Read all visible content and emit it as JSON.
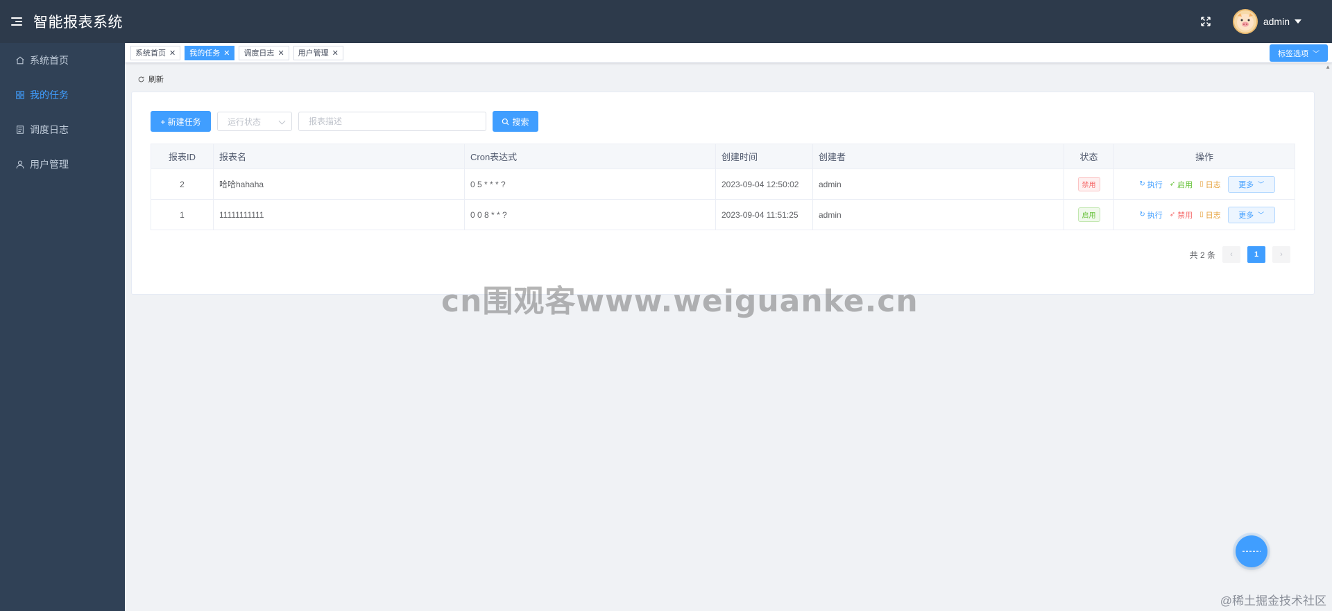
{
  "header": {
    "title": "智能报表系统",
    "username": "admin"
  },
  "sidebar": {
    "items": [
      {
        "label": "系统首页",
        "icon": "home-icon"
      },
      {
        "label": "我的任务",
        "icon": "grid-icon",
        "active": true
      },
      {
        "label": "调度日志",
        "icon": "document-icon"
      },
      {
        "label": "用户管理",
        "icon": "user-icon"
      }
    ]
  },
  "tags": {
    "items": [
      "系统首页",
      "我的任务",
      "调度日志",
      "用户管理"
    ],
    "active_index": 1,
    "options_label": "标签选项"
  },
  "toolbar": {
    "refresh_label": "刷新",
    "new_task_label": "+ 新建任务",
    "status_placeholder": "运行状态",
    "desc_placeholder": "报表描述",
    "search_label": "搜索"
  },
  "table": {
    "headers": [
      "报表ID",
      "报表名",
      "Cron表达式",
      "创建时间",
      "创建者",
      "状态",
      "操作"
    ],
    "rows": [
      {
        "id": "2",
        "name": "哈哈hahaha",
        "cron": "0 5 * * * ?",
        "created": "2023-09-04 12:50:02",
        "creator": "admin",
        "status": "禁用",
        "status_color": "#f56c6c",
        "toggle": "启用",
        "toggle_color": "#67c23a"
      },
      {
        "id": "1",
        "name": "11111111111",
        "cron": "0 0 8 * * ?",
        "created": "2023-09-04 11:51:25",
        "creator": "admin",
        "status": "启用",
        "status_color": "#67c23a",
        "toggle": "禁用",
        "toggle_color": "#f56c6c"
      }
    ],
    "ops": {
      "execute": "执行",
      "log": "日志",
      "more": "更多"
    }
  },
  "pagination": {
    "total_text": "共 2 条",
    "current": "1"
  },
  "watermark": "cn围观客www.weiguanke.cn",
  "footer_credit": "@稀土掘金技术社区",
  "colors": {
    "primary": "#409eff",
    "header_bg": "#2d3a4b",
    "sidebar_bg": "#304156"
  }
}
